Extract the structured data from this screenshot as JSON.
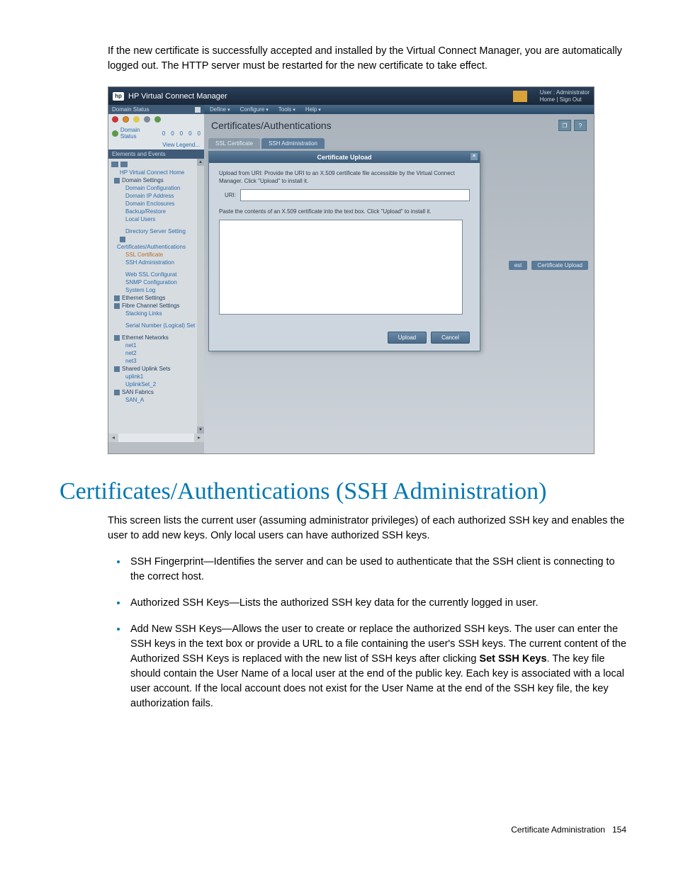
{
  "intro": "If the new certificate is successfully accepted and installed by the Virtual Connect Manager, you are automatically logged out. The HTTP server must be restarted for the new certificate to take effect.",
  "app": {
    "logo_text": "hp",
    "title": "HP Virtual Connect Manager",
    "user_label": "User : Administrator",
    "home_link": "Home",
    "signout_link": "Sign Out"
  },
  "menubar": {
    "define": "Define",
    "configure": "Configure",
    "tools": "Tools",
    "help": "Help"
  },
  "sidebar": {
    "domain_status_hdr": "Domain Status",
    "status_label": "Domain Status",
    "status_nums": [
      "0",
      "0",
      "0",
      "0",
      "0"
    ],
    "view_legend": "View Legend...",
    "elements_hdr": "Elements and Events",
    "items": {
      "vc_home": "HP Virtual Connect Home",
      "domain_settings": "Domain Settings",
      "domain_config": "Domain Configuration",
      "domain_ip": "Domain IP Address",
      "domain_enc": "Domain Enclosures",
      "backup": "Backup/Restore",
      "local_users": "Local Users",
      "dir_server": "Directory Server Setting",
      "cert_auth": "Certificates/Authentications",
      "ssl_cert": "SSL Certificate",
      "ssh_admin": "SSH Administration",
      "web_ssl": "Web SSL Configurat",
      "snmp": "SNMP Configuration",
      "syslog": "System Log",
      "eth_settings": "Ethernet Settings",
      "fc_settings": "Fibre Channel Settings",
      "stacking": "Stacking Links",
      "serial": "Serial Number (Logical) Set",
      "eth_net": "Ethernet Networks",
      "net1": "net1",
      "net2": "net2",
      "net3": "net3",
      "shared_uplink": "Shared Uplink Sets",
      "uplink1": "uplink1",
      "uplinkset2": "UplinkSet_2",
      "san_fabrics": "SAN Fabrics",
      "san_a": "SAN_A"
    }
  },
  "main": {
    "page_title": "Certificates/Authentications",
    "tab_ssl": "SSL Certificate",
    "tab_ssh": "SSH Administration",
    "hidden_btn1": "est",
    "hidden_btn2": "Certificate Upload"
  },
  "modal": {
    "title": "Certificate Upload",
    "instr1": "Upload from URI: Provide the URI to an X.509 certificate file accessible by the Virtual Connect Manager. Click \"Upload\" to install it.",
    "url_label": "URI:",
    "url_value": "",
    "instr2": "Paste the contents of an X.509 certificate into the text box. Click \"Upload\" to install it.",
    "textarea_value": "",
    "upload_btn": "Upload",
    "cancel_btn": "Cancel"
  },
  "section": {
    "heading": "Certificates/Authentications (SSH Administration)",
    "p1": "This screen lists the current user (assuming administrator privileges) of each authorized SSH key and enables the user to add new keys. Only local users can have authorized SSH keys.",
    "b1": "SSH Fingerprint—Identifies the server and can be used to authenticate that the SSH client is connecting to the correct host.",
    "b2": "Authorized SSH Keys—Lists the authorized SSH key data for the currently logged in user.",
    "b3a": "Add New SSH Keys—Allows the user to create or replace the authorized SSH keys. The user can enter the SSH keys in the text box or provide a URL to a file containing the user's SSH keys. The current content of the Authorized SSH Keys is replaced with the new list of SSH keys after clicking ",
    "b3_bold": "Set SSH Keys",
    "b3b": ". The key file should contain the User Name of a local user at the end of the public key. Each key is associated with a local user account. If the local account does not exist for the User Name at the end of the SSH key file, the key authorization fails."
  },
  "footer": {
    "label": "Certificate Administration",
    "page": "154"
  }
}
